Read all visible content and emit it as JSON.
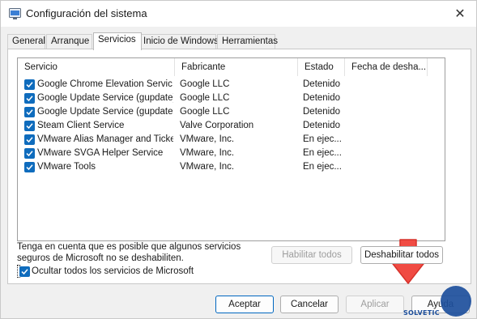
{
  "window": {
    "title": "Configuración del sistema",
    "close_glyph": "✕"
  },
  "tabs": [
    {
      "label": "General"
    },
    {
      "label": "Arranque"
    },
    {
      "label": "Servicios",
      "active": true
    },
    {
      "label": "Inicio de Windows"
    },
    {
      "label": "Herramientas"
    }
  ],
  "columns": [
    "Servicio",
    "Fabricante",
    "Estado",
    "Fecha de desha..."
  ],
  "services": [
    {
      "name": "Google Chrome Elevation Servic...",
      "vendor": "Google LLC",
      "status": "Detenido",
      "checked": true
    },
    {
      "name": "Google Update Service (gupdate)",
      "vendor": "Google LLC",
      "status": "Detenido",
      "checked": true
    },
    {
      "name": "Google Update Service (gupdatem)",
      "vendor": "Google LLC",
      "status": "Detenido",
      "checked": true
    },
    {
      "name": "Steam Client Service",
      "vendor": "Valve Corporation",
      "status": "Detenido",
      "checked": true
    },
    {
      "name": "VMware Alias Manager and Ticke...",
      "vendor": "VMware, Inc.",
      "status": "En ejec...",
      "checked": true
    },
    {
      "name": "VMware SVGA Helper Service",
      "vendor": "VMware, Inc.",
      "status": "En ejec...",
      "checked": true
    },
    {
      "name": "VMware Tools",
      "vendor": "VMware, Inc.",
      "status": "En ejec...",
      "checked": true
    }
  ],
  "note": "Tenga en cuenta que es posible que algunos servicios seguros de Microsoft no se deshabiliten.",
  "buttons": {
    "enable_all": "Habilitar todos",
    "disable_all": "Deshabilitar todos",
    "ok": "Aceptar",
    "cancel": "Cancelar",
    "apply": "Aplicar",
    "help": "Ayuda"
  },
  "hide_microsoft": {
    "label": "Ocultar todos los servicios de Microsoft",
    "checked": true
  },
  "watermark": {
    "text": "SOLVETIC"
  },
  "colors": {
    "accent": "#0f6cbd",
    "arrow": "#f04b43",
    "watermark": "#1d4f9c"
  },
  "icons": {
    "app": "system-config-icon",
    "check": "checkmark-icon",
    "arrow": "red-down-arrow-icon"
  }
}
